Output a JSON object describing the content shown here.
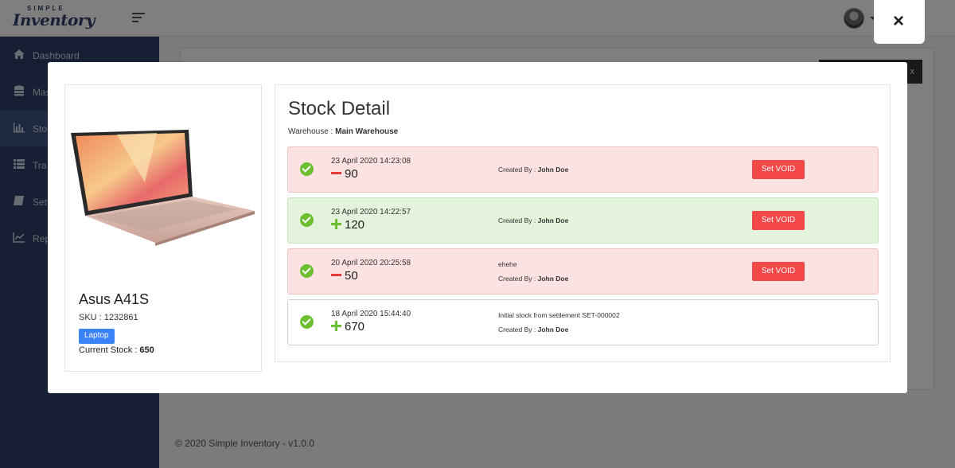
{
  "app": {
    "logo_small": "SIMPLE",
    "logo_big": "Inventory",
    "footer": "© 2020 Simple Inventory - v1.0.0",
    "bg_button_fragment": "x"
  },
  "sidebar": {
    "items": [
      {
        "label": "Dashboard",
        "icon": "home-icon"
      },
      {
        "label": "Mas",
        "icon": "database-icon"
      },
      {
        "label": "Sto",
        "icon": "bar-chart-icon"
      },
      {
        "label": "Tra",
        "icon": "list-icon"
      },
      {
        "label": "Sett",
        "icon": "book-icon"
      },
      {
        "label": "Rep",
        "icon": "line-chart-icon"
      }
    ]
  },
  "modal": {
    "close_label": "×",
    "product": {
      "name": "Asus A41S",
      "sku_label": "SKU : ",
      "sku": "1232861",
      "category": "Laptop",
      "current_stock_label": "Current Stock : ",
      "current_stock": "650"
    },
    "detail": {
      "title": "Stock Detail",
      "warehouse_label": "Warehouse : ",
      "warehouse": "Main Warehouse",
      "created_by_label": "Created By : ",
      "void_label": "Set VOID",
      "entries": [
        {
          "date": "23 April 2020 14:23:08",
          "sign": "minus",
          "qty": "90",
          "note": "",
          "created_by": "John Doe",
          "type": "neg",
          "voidable": true
        },
        {
          "date": "23 April 2020 14:22:57",
          "sign": "plus",
          "qty": "120",
          "note": "",
          "created_by": "John Doe",
          "type": "pos",
          "voidable": true
        },
        {
          "date": "20 April 2020 20:25:58",
          "sign": "minus",
          "qty": "50",
          "note": "ehehe",
          "created_by": "John Doe",
          "type": "neg",
          "voidable": true
        },
        {
          "date": "18 April 2020 15:44:40",
          "sign": "plus",
          "qty": "670",
          "note": "Initial stock from settlement SET-000002",
          "created_by": "John Doe",
          "type": "neutral",
          "voidable": false
        }
      ]
    }
  },
  "colors": {
    "sidebar": "#2c3e66",
    "danger": "#f44848",
    "success": "#6cbf2e",
    "primary": "#3b82f6"
  }
}
